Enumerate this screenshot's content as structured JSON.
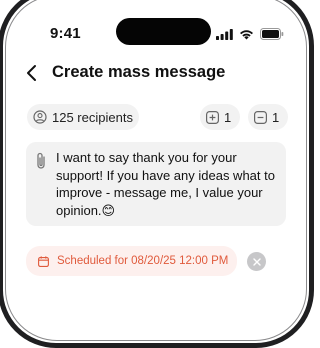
{
  "status_bar": {
    "time": "9:41"
  },
  "header": {
    "title": "Create mass message"
  },
  "recipients": {
    "count_label": "125 recipients"
  },
  "counters": [
    {
      "value": "1"
    },
    {
      "value": "1"
    }
  ],
  "message": {
    "text": "I want to say thank you for your support! If you have any ideas what to improve - message me, I value your opinion.😊"
  },
  "schedule": {
    "label": "Scheduled for 08/20/25 12:00 PM"
  },
  "colors": {
    "accent": "#e05a3c",
    "pill_bg": "#f2f2f2",
    "schedule_bg": "#fdf0ee"
  }
}
